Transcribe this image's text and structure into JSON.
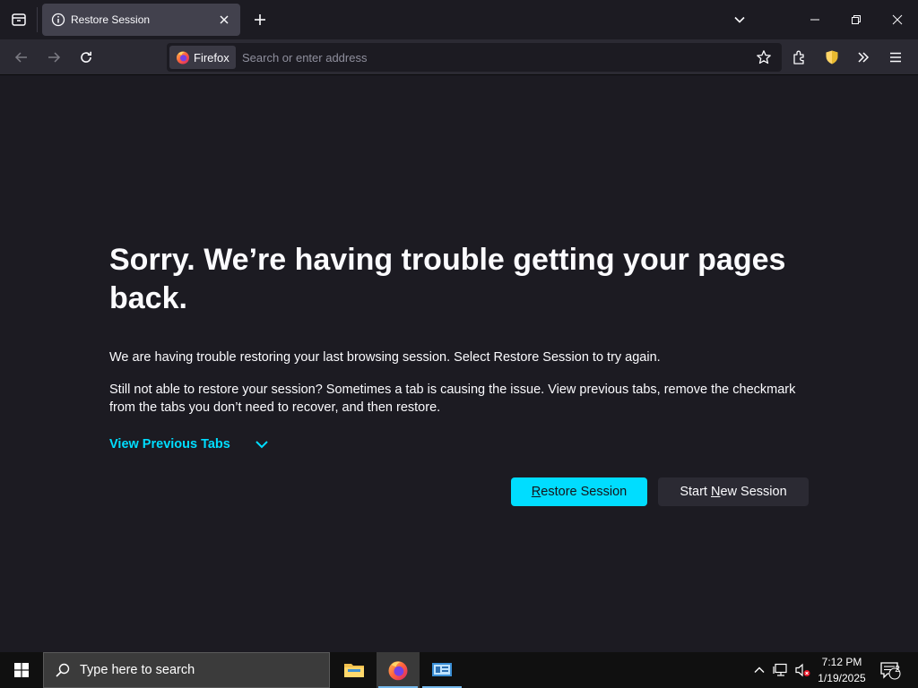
{
  "browser": {
    "tab": {
      "title": "Restore Session"
    },
    "urlbar": {
      "identity_label": "Firefox",
      "placeholder": "Search or enter address"
    }
  },
  "page": {
    "title": "Sorry. We’re having trouble getting your pages back.",
    "paragraph1": "We are having trouble restoring your last browsing session. Select Restore Session to try again.",
    "paragraph2": "Still not able to restore your session? Sometimes a tab is causing the issue. View previous tabs, remove the checkmark from the tabs you don’t need to recover, and then restore.",
    "view_previous_tabs": "View Previous Tabs",
    "restore_button": {
      "pre": "",
      "accel": "R",
      "post": "estore Session"
    },
    "new_session_button": {
      "pre": "Start ",
      "accel": "N",
      "post": "ew Session"
    }
  },
  "taskbar": {
    "search_placeholder": "Type here to search",
    "time": "7:12 PM",
    "date": "1/19/2025",
    "notification_count": "2"
  },
  "colors": {
    "accent": "#00ddff",
    "background": "#1c1b22",
    "toolbar": "#2b2a33",
    "tab_active": "#42414d",
    "shield": "#ffd567"
  },
  "icons": [
    "tab-list-icon",
    "info-icon",
    "close-icon",
    "plus-icon",
    "chevron-down-icon",
    "minimize-icon",
    "restore-window-icon",
    "back-arrow-icon",
    "forward-arrow-icon",
    "reload-icon",
    "firefox-icon",
    "star-icon",
    "extensions-icon",
    "shield-icon",
    "overflow-chevrons-icon",
    "hamburger-menu-icon",
    "windows-start-icon",
    "search-icon",
    "file-explorer-icon",
    "control-panel-icon",
    "network-icon",
    "volume-muted-icon",
    "notification-icon"
  ]
}
